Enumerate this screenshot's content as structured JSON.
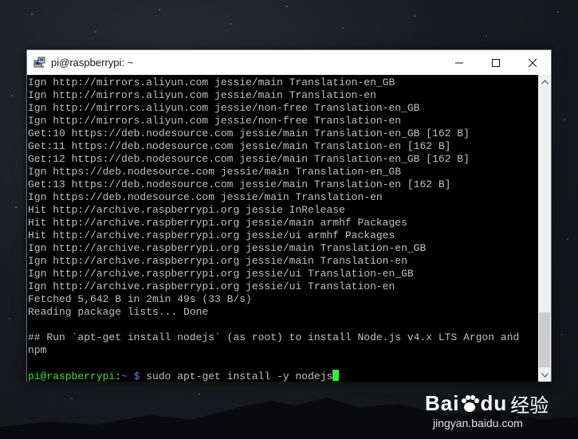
{
  "window": {
    "title": "pi@raspberrypi: ~",
    "controls": {
      "minimize": "minimize",
      "maximize": "maximize",
      "close": "close"
    }
  },
  "terminal": {
    "lines": [
      "Ign http://mirrors.aliyun.com jessie/main Translation-en_GB",
      "Ign http://mirrors.aliyun.com jessie/main Translation-en",
      "Ign http://mirrors.aliyun.com jessie/non-free Translation-en_GB",
      "Ign http://mirrors.aliyun.com jessie/non-free Translation-en",
      "Get:10 https://deb.nodesource.com jessie/main Translation-en_GB [162 B]",
      "Get:11 https://deb.nodesource.com jessie/main Translation-en [162 B]",
      "Get:12 https://deb.nodesource.com jessie/main Translation-en_GB [162 B]",
      "Ign https://deb.nodesource.com jessie/main Translation-en_GB",
      "Get:13 https://deb.nodesource.com jessie/main Translation-en [162 B]",
      "Ign https://deb.nodesource.com jessie/main Translation-en",
      "Hit http://archive.raspberrypi.org jessie InRelease",
      "Hit http://archive.raspberrypi.org jessie/main armhf Packages",
      "Hit http://archive.raspberrypi.org jessie/ui armhf Packages",
      "Ign http://archive.raspberrypi.org jessie/main Translation-en_GB",
      "Ign http://archive.raspberrypi.org jessie/main Translation-en",
      "Ign http://archive.raspberrypi.org jessie/ui Translation-en_GB",
      "Ign http://archive.raspberrypi.org jessie/ui Translation-en",
      "Fetched 5,642 B in 2min 49s (33 B/s)",
      "Reading package lists... Done",
      "",
      "## Run `apt-get install nodejs` (as root) to install Node.js v4.x LTS Argon and",
      "npm",
      ""
    ],
    "prompt": {
      "user_host": "pi@raspberrypi",
      "separator": ":",
      "path": "~ $",
      "command": " sudo apt-get install -y nodejs"
    }
  },
  "watermark": {
    "logo_text": "Bai",
    "logo_text2": "du",
    "cn_text": "经验",
    "url": "jingyan.baidu.com"
  },
  "colors": {
    "prompt_user": "#36e52e",
    "prompt_path": "#5a7bff",
    "terminal_text": "#c0c0c0",
    "cursor": "#2cf22c"
  }
}
